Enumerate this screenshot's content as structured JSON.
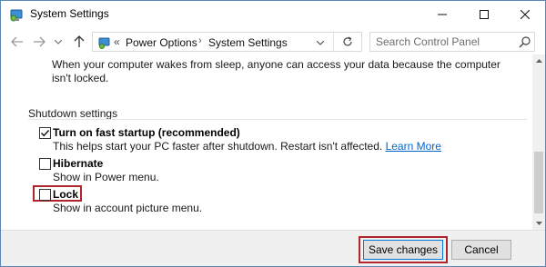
{
  "window": {
    "title": "System Settings",
    "icons": {
      "app": "control-panel-icon",
      "minimize": "minimize-icon",
      "maximize": "maximize-icon",
      "close": "close-icon"
    }
  },
  "nav": {
    "icons": {
      "back": "back-arrow-icon",
      "forward": "forward-arrow-icon",
      "recent": "chevron-down-icon",
      "up": "up-arrow-icon",
      "refresh": "refresh-icon"
    },
    "breadcrumb_prefix": "«",
    "breadcrumb": [
      "Power Options",
      "System Settings"
    ],
    "breadcrumb_separator": "›",
    "search_placeholder": "Search Control Panel"
  },
  "content": {
    "top_description": "When your computer wakes from sleep, anyone can access your data because the computer isn't locked.",
    "section_title": "Shutdown settings",
    "options": [
      {
        "label": "Turn on fast startup (recommended)",
        "description": "This helps start your PC faster after shutdown. Restart isn't affected.",
        "link": "Learn More",
        "checked": true
      },
      {
        "label": "Hibernate",
        "description": "Show in Power menu.",
        "checked": false
      },
      {
        "label": "Lock",
        "description": "Show in account picture menu.",
        "checked": false
      }
    ]
  },
  "footer": {
    "save_label": "Save changes",
    "cancel_label": "Cancel"
  },
  "colors": {
    "highlight_border": "#b0262c",
    "link": "#0066cc",
    "window_border": "#5a87b8"
  }
}
